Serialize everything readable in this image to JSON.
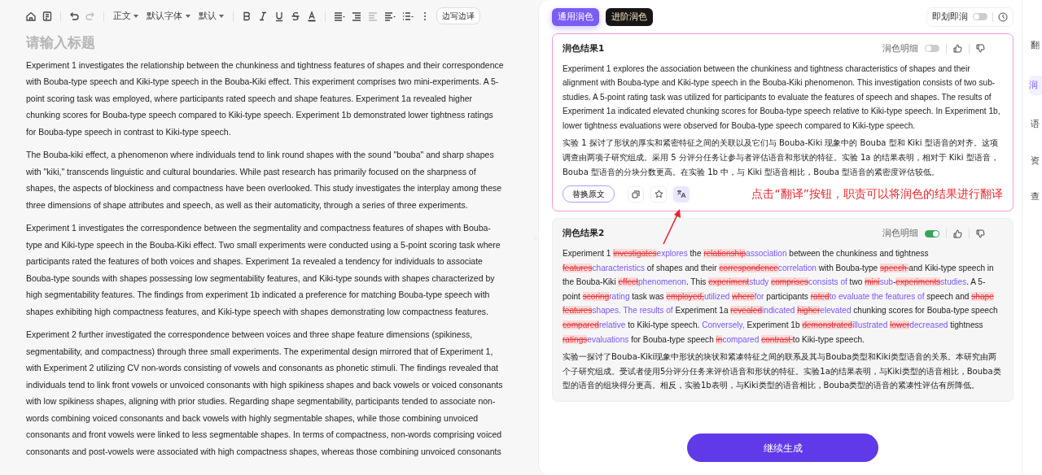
{
  "toolbar": [
    {
      "kind": "home",
      "disabled": false
    },
    {
      "kind": "outline",
      "disabled": false
    },
    {
      "kind": "sep"
    },
    {
      "kind": "undo",
      "disabled": false
    },
    {
      "kind": "redo",
      "disabled": true
    },
    {
      "kind": "sep"
    },
    {
      "kind": "dropdown",
      "label": "正文"
    },
    {
      "kind": "dropdown",
      "label": "默认字体"
    },
    {
      "kind": "dropdown",
      "label": "默认"
    },
    {
      "kind": "sep"
    },
    {
      "kind": "bold",
      "disabled": false
    },
    {
      "kind": "italic",
      "disabled": false
    },
    {
      "kind": "underline",
      "disabled": false
    },
    {
      "kind": "strike",
      "disabled": false
    },
    {
      "kind": "color",
      "disabled": false
    },
    {
      "kind": "sep"
    },
    {
      "kind": "align",
      "disabled": false
    },
    {
      "kind": "indent",
      "disabled": false
    },
    {
      "kind": "outdent",
      "disabled": true
    },
    {
      "kind": "lines",
      "disabled": false
    },
    {
      "kind": "list",
      "disabled": false
    },
    {
      "kind": "more",
      "disabled": false
    },
    {
      "kind": "pill",
      "label": "边写边译"
    }
  ],
  "editor": {
    "title_placeholder": "请输入标题",
    "paragraphs": [
      "Experiment 1 investigates the relationship between the chunkiness and tightness features of shapes and their correspondence with Bouba-type speech and Kiki-type speech in the Bouba-Kiki effect. This experiment comprises two mini-experiments. A 5-point scoring task was employed, where participants rated speech and shape features. Experiment 1a revealed higher chunking scores for Bouba-type speech compared to Kiki-type speech. Experiment 1b demonstrated lower tightness ratings for Bouba-type speech in contrast to Kiki-type speech.",
      "The Bouba-kiki effect, a phenomenon where individuals tend to link round shapes with the sound \"bouba\" and sharp shapes with \"kiki,\" transcends linguistic and cultural boundaries. While past research has primarily focused on the sharpness of shapes, the aspects of blockiness and compactness have been overlooked. This study investigates the interplay among these three dimensions of shape attributes and speech, as well as their automaticity, through a series of three experiments.",
      "Experiment 1 investigates the correspondence between the segmentality and compactness features of shapes with Bouba-type and Kiki-type speech in the Bouba-Kiki effect. Two small experiments were conducted using a 5-point scoring task where participants rated the features of both voices and shapes. Experiment 1a revealed a tendency for individuals to associate Bouba-type sounds with shapes possessing low segmentability features, and Kiki-type sounds with shapes characterized by high segmentability features. The findings from experiment 1b indicated a preference for matching Bouba-type speech with shapes exhibiting high compactness features, and Kiki-type speech with shapes demonstrating low compactness features.",
      "Experiment 2 further investigated the correspondence between voices and three shape feature dimensions (spikiness, segmentability, and compactness) through three small experiments. The experimental design mirrored that of Experiment 1, with Experiment 2 utilizing CV non-words consisting of vowels and consonants as phonetic stimuli. The findings revealed that individuals tend to link front vowels or unvoiced consonants with high spikiness shapes and back vowels or voiced consonants with low spikiness shapes, aligning with prior studies. Regarding shape segmentability, participants tended to associate non-words combining voiced consonants and back vowels with highly segmentable shapes, while those combining unvoiced consonants and front vowels were linked to less segmentable shapes. In terms of compactness, non-words comprising voiced consonants and post-vowels were associated with high compactness shapes, whereas those combining unvoiced consonants"
    ]
  },
  "panel": {
    "tabs": [
      {
        "label": "通用润色",
        "selected": true
      },
      {
        "label": "进阶润色",
        "selected": false
      }
    ],
    "instant": {
      "label": "即划即润",
      "on": false
    },
    "results": [
      {
        "title": "润色结果1",
        "selected": true,
        "detail_label": "润色明细",
        "detail_on": false,
        "english": "Experiment 1 explores the association between the chunkiness and tightness characteristics of shapes and their alignment with Bouba-type and Kiki-type speech in the Bouba-Kiki phenomenon. This investigation consists of two sub-studies. A 5-point rating task was utilized for participants to evaluate the features of speech and shapes. The results of Experiment 1a indicated elevated chunking scores for Bouba-type speech relative to Kiki-type speech. In Experiment 1b, lower tightness evaluations were observed for Bouba-type speech compared to Kiki-type speech.",
        "chinese": "实验 1 探讨了形状的厚实和紧密特征之间的关联以及它们与 Bouba-Kiki 现象中的 Bouba 型和 Kiki 型语音的对齐。这项调查由两项子研究组成。采用 5 分评分任务让参与者评估语音和形状的特征。实验 1a 的结果表明，相对于 Kiki 型语音，Bouba 型语音的分块分数更高。在实验 1b 中，与 Kiki 型语音相比，Bouba 型语音的紧密度评估较低。",
        "replace_label": "替换原文",
        "annotation": "点击“翻译”按钮，职责可以将润色的结果进行翻译"
      },
      {
        "title": "润色结果2",
        "selected": false,
        "detail_label": "润色明细",
        "detail_on": true,
        "diff": [
          {
            "kind": "same",
            "text": "Experiment 1 "
          },
          {
            "kind": "del",
            "text": "investigates"
          },
          {
            "kind": "ins",
            "text": "explores"
          },
          {
            "kind": "same",
            "text": " the "
          },
          {
            "kind": "del",
            "text": "relationship"
          },
          {
            "kind": "ins",
            "text": "association"
          },
          {
            "kind": "same",
            "text": " between the chunkiness and tightness "
          },
          {
            "kind": "del",
            "text": "features"
          },
          {
            "kind": "ins",
            "text": "characteristics"
          },
          {
            "kind": "same",
            "text": " of shapes and their "
          },
          {
            "kind": "del",
            "text": "correspondence"
          },
          {
            "kind": "ins",
            "text": "correlation"
          },
          {
            "kind": "same",
            "text": " with Bouba-type "
          },
          {
            "kind": "del",
            "text": "speech "
          },
          {
            "kind": "same",
            "text": "and Kiki-type speech in the Bouba-Kiki "
          },
          {
            "kind": "del",
            "text": "effect"
          },
          {
            "kind": "ins",
            "text": "phenomenon"
          },
          {
            "kind": "same",
            "text": ". This "
          },
          {
            "kind": "del",
            "text": "experiment"
          },
          {
            "kind": "ins",
            "text": "study "
          },
          {
            "kind": "del",
            "text": "comprises"
          },
          {
            "kind": "ins",
            "text": "consists of"
          },
          {
            "kind": "same",
            "text": " two "
          },
          {
            "kind": "del",
            "text": "mini"
          },
          {
            "kind": "ins",
            "text": "sub"
          },
          {
            "kind": "same",
            "text": "-"
          },
          {
            "kind": "del",
            "text": "experiments"
          },
          {
            "kind": "ins",
            "text": "studies"
          },
          {
            "kind": "same",
            "text": ". A 5-point "
          },
          {
            "kind": "del",
            "text": "scoring"
          },
          {
            "kind": "ins",
            "text": "rating"
          },
          {
            "kind": "same",
            "text": " task was "
          },
          {
            "kind": "del",
            "text": "employed,"
          },
          {
            "kind": "ins",
            "text": "utilized "
          },
          {
            "kind": "del",
            "text": "where"
          },
          {
            "kind": "ins",
            "text": "for"
          },
          {
            "kind": "same",
            "text": " participants "
          },
          {
            "kind": "del",
            "text": "rated"
          },
          {
            "kind": "ins",
            "text": "to evaluate the features of"
          },
          {
            "kind": "same",
            "text": " speech and "
          },
          {
            "kind": "del",
            "text": "shape features"
          },
          {
            "kind": "ins",
            "text": "shapes. The results of"
          },
          {
            "kind": "same",
            "text": " Experiment 1a "
          },
          {
            "kind": "del",
            "text": "revealed"
          },
          {
            "kind": "ins",
            "text": "indicated "
          },
          {
            "kind": "del",
            "text": "higher"
          },
          {
            "kind": "ins",
            "text": "elevated"
          },
          {
            "kind": "same",
            "text": " chunking scores for Bouba-type speech "
          },
          {
            "kind": "del",
            "text": "compared"
          },
          {
            "kind": "ins",
            "text": "relative"
          },
          {
            "kind": "same",
            "text": " to Kiki-type speech. "
          },
          {
            "kind": "ins",
            "text": "Conversely,"
          },
          {
            "kind": "same",
            "text": " Experiment 1b "
          },
          {
            "kind": "del",
            "text": "demonstrated"
          },
          {
            "kind": "ins",
            "text": "illustrated "
          },
          {
            "kind": "del",
            "text": "lower"
          },
          {
            "kind": "ins",
            "text": "decreased"
          },
          {
            "kind": "same",
            "text": " tightness "
          },
          {
            "kind": "del",
            "text": "ratings"
          },
          {
            "kind": "ins",
            "text": "evaluations"
          },
          {
            "kind": "same",
            "text": " for Bouba-type speech "
          },
          {
            "kind": "del",
            "text": "in"
          },
          {
            "kind": "ins",
            "text": "compared "
          },
          {
            "kind": "del",
            "text": "contrast "
          },
          {
            "kind": "same",
            "text": "to Kiki-type speech."
          }
        ],
        "chinese": "实验一探讨了Bouba-Kiki现象中形状的块状和紧凑特征之间的联系及其与Bouba类型和Kiki类型语音的关系。本研究由两个子研究组成。受试者使用5分评分任务来评价语音和形状的特征。实验1a的结果表明，与Kiki类型的语音相比，Bouba类型的语音的组块得分更高。相反，实验1b表明，与Kiki类型的语音相比，Bouba类型的语音的紧凑性评估有所降低。"
      }
    ],
    "continue_label": "继续生成"
  },
  "side_tabs": [
    {
      "label": "翻",
      "selected": false
    },
    {
      "label": "润",
      "selected": true
    },
    {
      "label": "语",
      "selected": false
    },
    {
      "label": "资",
      "selected": false
    },
    {
      "label": "查",
      "selected": false
    }
  ]
}
